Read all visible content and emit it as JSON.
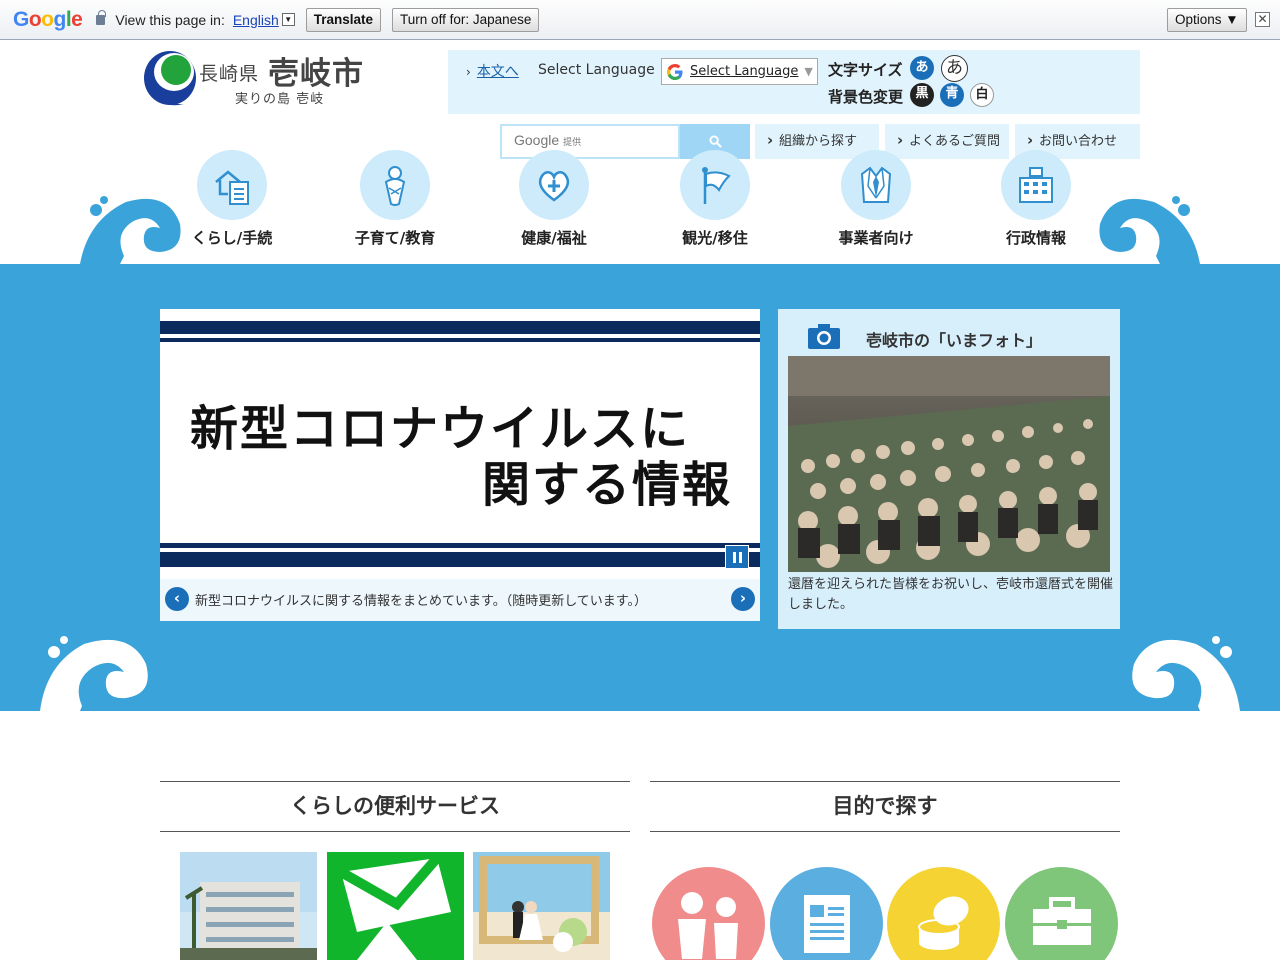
{
  "translate_bar": {
    "logo": "Google",
    "view_text": "View this page in:",
    "language": "English",
    "translate_label": "Translate",
    "turn_off_label": "Turn off for: Japanese",
    "options_label": "Options ▼",
    "close_glyph": "✕"
  },
  "header": {
    "pref": "長崎県",
    "city": "壱岐市",
    "tagline": "実りの島 壱岐",
    "skip_link": "本文へ",
    "select_language_label": "Select Language",
    "select_language_value": "Select Language",
    "select_language_arrow": "▼",
    "font_size_label": "文字サイズ",
    "font_small": "あ",
    "font_large": "あ",
    "bg_label": "背景色変更",
    "bg_black": "黒",
    "bg_blue": "青",
    "bg_white": "白",
    "search_brand": "Google",
    "search_brand_sub": "提供",
    "tabs": [
      "組織から探す",
      "よくあるご質問",
      "お問い合わせ"
    ]
  },
  "categories": [
    {
      "label": "くらし/手続",
      "icon": "house-document-icon"
    },
    {
      "label": "子育て/教育",
      "icon": "baby-icon"
    },
    {
      "label": "健康/福祉",
      "icon": "heart-plus-icon"
    },
    {
      "label": "観光/移住",
      "icon": "flag-icon"
    },
    {
      "label": "事業者向け",
      "icon": "suit-icon"
    },
    {
      "label": "行政情報",
      "icon": "city-hall-icon"
    }
  ],
  "slider": {
    "line1": "新型コロナウイルスに",
    "line2": "関する情報",
    "caption": "新型コロナウイルスに関する情報をまとめています。（随時更新しています。）",
    "prev": "‹",
    "next": "›"
  },
  "photo": {
    "title": "壱岐市の「いまフォト」",
    "caption": "還暦を迎えられた皆様をお祝いし、壱岐市還暦式を開催しました。"
  },
  "sections": {
    "services_title": "くらしの便利サービス",
    "purpose_title": "目的で探す"
  },
  "colors": {
    "brand_blue": "#3aa3d9",
    "accent": "#1b6fb8",
    "navy": "#0b2a5e"
  }
}
